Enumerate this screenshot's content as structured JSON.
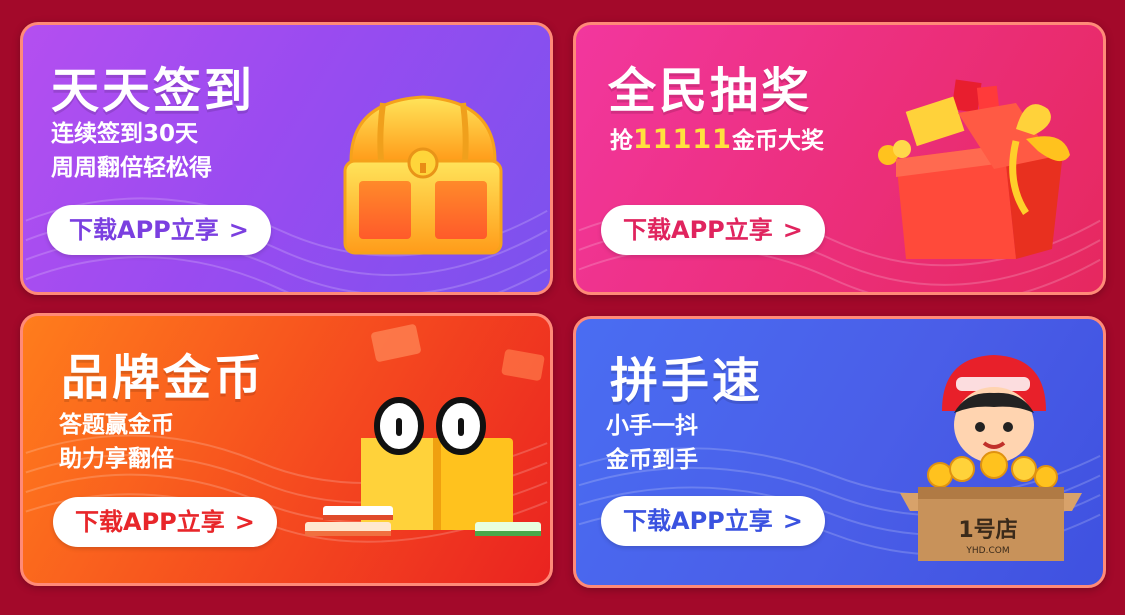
{
  "cards": [
    {
      "title": "天天签到",
      "line1": "连续签到30天",
      "line2": "周周翻倍轻松得",
      "button": "下载APP立享",
      "arrow": ">",
      "button_color": "#7b3fe0",
      "icon": "treasure-chest-icon"
    },
    {
      "title": "全民抽奖",
      "line1_prefix": "抢",
      "line1_highlight": "11111",
      "line1_suffix": "金币大奖",
      "button": "下载APP立享",
      "arrow": ">",
      "button_color": "#e0245e",
      "highlight_color": "#ffe23d",
      "icon": "gift-box-icon"
    },
    {
      "title": "品牌金币",
      "line1": "答题赢金币",
      "line2": "助力享翻倍",
      "button": "下载APP立享",
      "arrow": ">",
      "button_color": "#e8262a",
      "icon": "book-with-eyes-icon"
    },
    {
      "title": "拼手速",
      "line1": "小手一抖",
      "line2": "金币到手",
      "button": "下载APP立享",
      "arrow": ">",
      "button_color": "#3a52e0",
      "icon": "courier-with-coin-box-icon",
      "box_text": "1号店",
      "box_caption": "YHD.COM"
    }
  ]
}
